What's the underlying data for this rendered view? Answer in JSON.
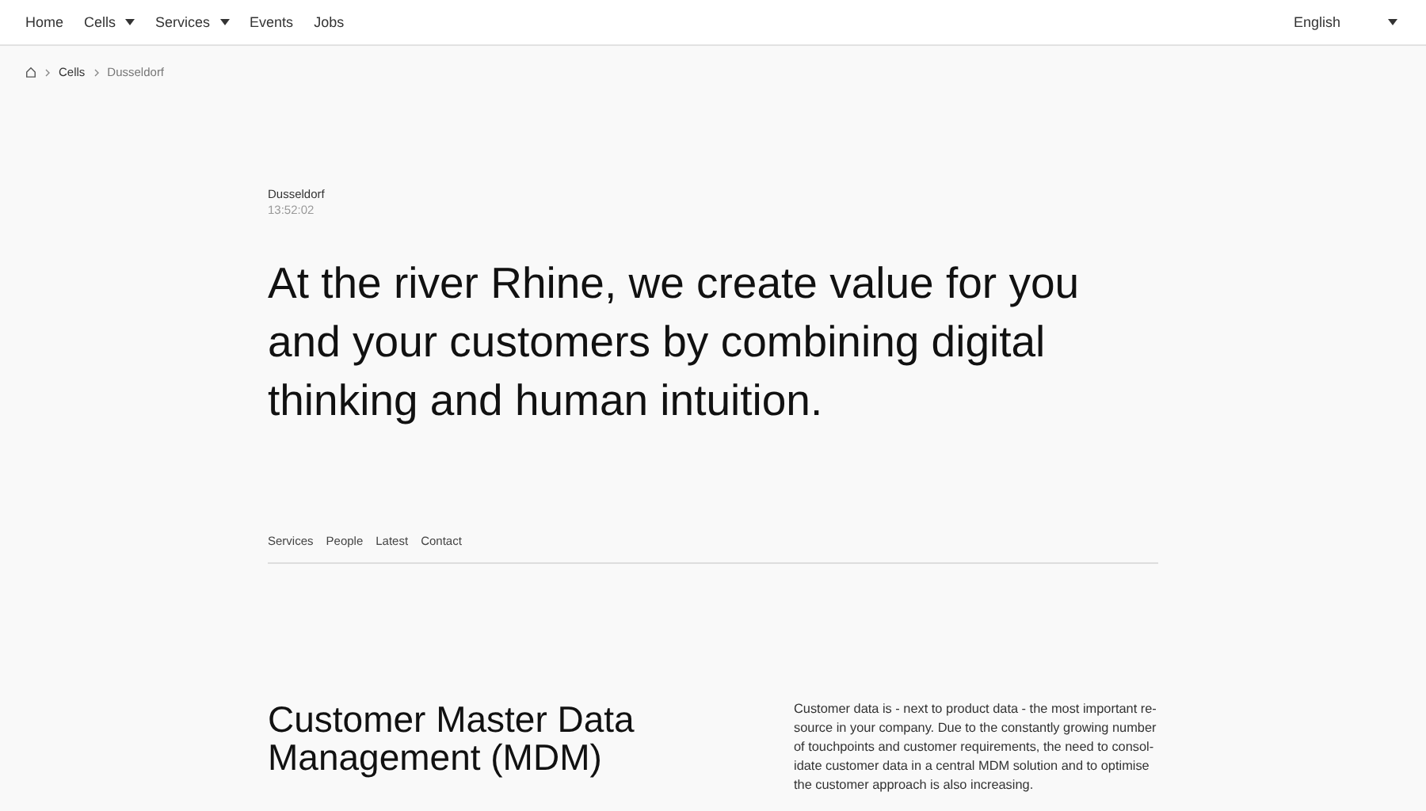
{
  "nav": {
    "items": [
      {
        "label": "Home",
        "dropdown": false
      },
      {
        "label": "Cells",
        "dropdown": true
      },
      {
        "label": "Services",
        "dropdown": true
      },
      {
        "label": "Events",
        "dropdown": false
      },
      {
        "label": "Jobs",
        "dropdown": false
      }
    ],
    "language": "English"
  },
  "breadcrumb": [
    "Cells",
    "Dusseldorf"
  ],
  "location": {
    "city": "Dusseldorf",
    "time": "13:52:02"
  },
  "headline": "At the river Rhine, we create value for you and your customers by combining digital thinking and human intuition.",
  "subnav": [
    "Services",
    "People",
    "Latest",
    "Contact"
  ],
  "section": {
    "title": "Customer Master Data Management (MDM)",
    "lines": [
      "Customer data is - next to product data - the most important re-",
      "source in your company. Due to the constantly growing number",
      "of touchpoints and customer requirements, the need to consol-",
      "idate customer data in a central MDM solution and to optimise",
      "the customer approach is also increasing."
    ]
  }
}
